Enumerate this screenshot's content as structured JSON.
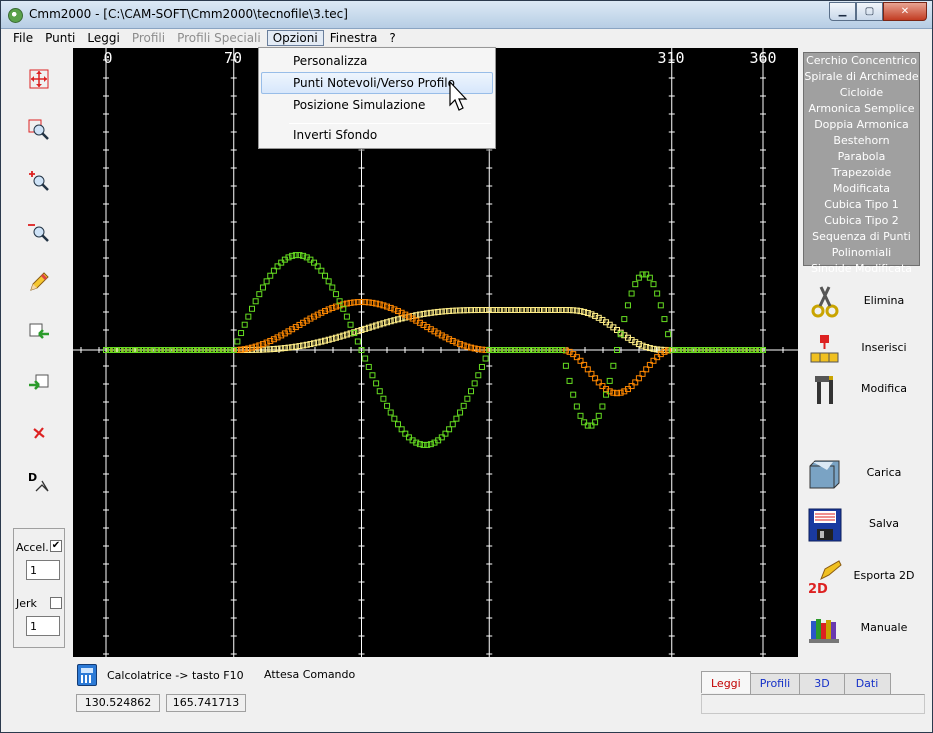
{
  "window": {
    "title": "Cmm2000 - [C:\\CAM-SOFT\\Cmm2000\\tecnofile\\3.tec]",
    "min": "▁",
    "max": "▢",
    "close": "✕"
  },
  "menu": [
    "File",
    "Punti",
    "Leggi",
    "Profili",
    "Profili Speciali",
    "Opzioni",
    "Finestra",
    "?"
  ],
  "menu_disabled": [
    false,
    false,
    false,
    true,
    true,
    false,
    false,
    false
  ],
  "menu_open": "Opzioni",
  "dropdown": [
    "Personalizza",
    "Punti Notevoli/Verso Profilo",
    "Posizione Simulazione",
    "Inverti Sfondo"
  ],
  "dropdown_hover": "Punti Notevoli/Verso Profilo",
  "left_tools": [
    "move-icon",
    "zoom-window-icon",
    "zoom-in-icon",
    "zoom-out-icon",
    "pencil-icon",
    "import-icon",
    "export-icon",
    "delete-icon",
    "dimension-icon"
  ],
  "options": {
    "accel_label": "Accel.",
    "accel_checked": "✔",
    "accel_value": "1",
    "jerk_label": "Jerk",
    "jerk_value": "1"
  },
  "axis_ticks": [
    "0",
    "70",
    "310",
    "360"
  ],
  "laws": [
    "Cerchio Concentrico",
    "Spirale di Archimede",
    "Cicloide",
    "Armonica Semplice",
    "Doppia Armonica",
    "Bestehorn",
    "Parabola",
    "Trapezoide Modificata",
    "Cubica Tipo 1",
    "Cubica Tipo 2",
    "Sequenza di Punti",
    "Polinomiali",
    "Sinoide Modificata"
  ],
  "side_buttons": [
    "Elimina",
    "Inserisci",
    "Modifica",
    "Carica",
    "Salva",
    "Esporta 2D",
    "Manuale"
  ],
  "status": {
    "calc": "Calcolatrice -> tasto F10",
    "message": "Attesa Comando",
    "x": "130.524862",
    "y": "165.741713"
  },
  "tabs": [
    "Leggi",
    "Profili",
    "3D",
    "Dati"
  ],
  "tab_active": "Leggi",
  "colors": {
    "canvas": "#000000",
    "grid": "#ffffff",
    "green": "#66dd22",
    "orange": "#ff8800",
    "yellow": "#ffee88",
    "accent_tab": "#c20000"
  }
}
